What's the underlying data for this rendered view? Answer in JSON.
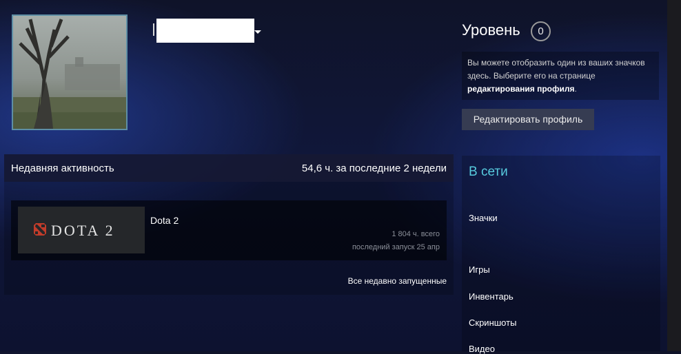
{
  "profile": {
    "name_redacted": true
  },
  "level": {
    "label": "Уровень",
    "value": "0"
  },
  "badge_note": {
    "text_before": "Вы можете отобразить один из ваших значков здесь. Выберите его на странице ",
    "link": "редактирования профиля",
    "text_after": "."
  },
  "edit_button": "Редактировать профиль",
  "activity": {
    "title": "Недавняя активность",
    "hours": "54,6 ч. за последние 2 недели",
    "game": {
      "capsule_text": "DOTA 2",
      "name": "Dota 2",
      "total": "1 804 ч. всего",
      "last_played": "последний запуск 25 апр"
    },
    "all_recent": "Все недавно запущенные"
  },
  "sidebar": {
    "status": "В сети",
    "items": [
      {
        "label": "Значки"
      },
      {
        "label": "Игры"
      },
      {
        "label": "Инвентарь"
      },
      {
        "label": "Скриншоты"
      },
      {
        "label": "Видео"
      }
    ]
  },
  "colors": {
    "online": "#57cbde",
    "avatar_border": "#5e8fa6",
    "dota_logo": "#c23c2a"
  }
}
